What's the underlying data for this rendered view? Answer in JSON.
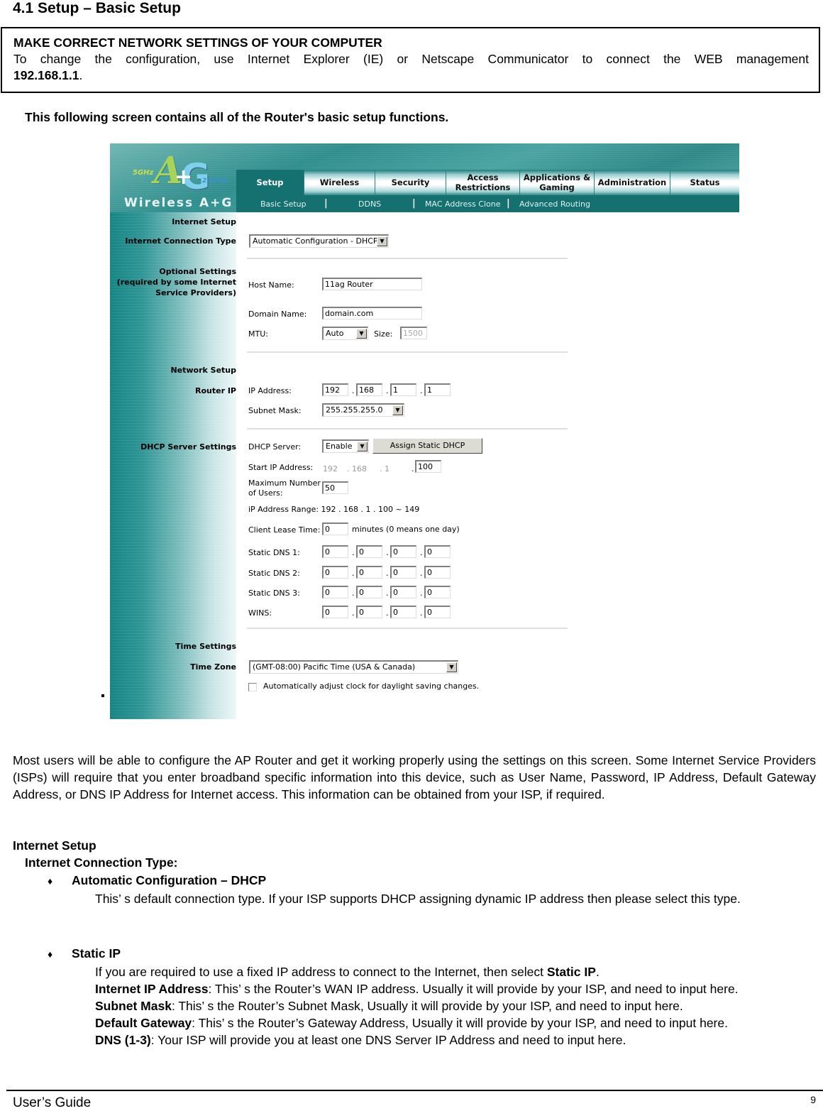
{
  "document": {
    "section_title": "4.1 Setup – Basic Setup",
    "notice": {
      "heading": "MAKE CORRECT NETWORK SETTINGS OF YOUR COMPUTER",
      "body": "To change the configuration, use Internet Explorer (IE) or Netscape Communicator to connect the WEB management",
      "ip": "192.168.1.1",
      "ip_suffix": "."
    },
    "intro": "This following screen contains all of the Router's basic setup functions.",
    "paragraph": "Most users will be able to configure the AP Router and get it working properly using the settings on this screen. Some Internet Service Providers (ISPs) will require that you enter broadband specific information into this device, such as User Name, Password, IP Address, Default Gateway Address, or DNS IP Address for Internet access. This information can be obtained from your ISP, if required.",
    "internet_setup_heading": "Internet Setup",
    "connection_type_heading": "Internet Connection Type:",
    "bullet_glyph": "♦",
    "bullets": [
      {
        "title": "Automatic Configuration – DHCP",
        "text": "This’ s default connection type. If your ISP supports DHCP assigning dynamic IP address then please select this type."
      },
      {
        "title": "Static IP",
        "lines": [
          {
            "pre": "If you are required to use a fixed IP address to connect to the Internet, then select ",
            "bold": "Static IP",
            "post": "."
          },
          {
            "bold": "Internet IP Address",
            "post": ": This’ s the Router’s WAN IP address. Usually it will provide by your ISP, and need to input here."
          },
          {
            "bold": "Subnet Mask",
            "post": ": This’ s the Router’s Subnet Mask, Usually it will provide by your ISP, and need to input here."
          },
          {
            "bold": "Default Gateway",
            "post": ": This’ s the Router’s Gateway Address, Usually it will provide by your ISP, and need to input here."
          },
          {
            "bold": "DNS (1-3)",
            "post": ": Your ISP will provide you at least one DNS Server IP Address and need to input here."
          }
        ]
      }
    ],
    "footer": {
      "left": "User’s Guide",
      "page": "9"
    }
  },
  "router_ui": {
    "logo": {
      "a": "A",
      "g": "G",
      "plus": "+",
      "band1": "5GHz",
      "band2": "2.4GHz",
      "wordmark": "Wireless A+G"
    },
    "tabs": [
      {
        "label": "Setup",
        "active": true
      },
      {
        "label": "Wireless"
      },
      {
        "label": "Security"
      },
      {
        "label": "Access Restrictions"
      },
      {
        "label": "Applications & Gaming"
      },
      {
        "label": "Administration"
      },
      {
        "label": "Status"
      }
    ],
    "subtabs": [
      "Basic Setup",
      "DDNS",
      "MAC Address Clone",
      "Advanced Routing"
    ],
    "subtab_separator": "|",
    "sections": {
      "internet_setup": "Internet Setup",
      "connection_type": "Internet Connection Type",
      "optional_settings": "Optional Settings",
      "optional_note1": "(required by some Internet",
      "optional_note2": "Service Providers)",
      "network_setup": "Network Setup",
      "router_ip": "Router IP",
      "dhcp_settings": "DHCP Server Settings",
      "time_settings": "Time Settings",
      "time_zone": "Time Zone"
    },
    "connection_type_value": "Automatic Configuration - DHCP",
    "host_name": {
      "label": "Host Name:",
      "value": "11ag Router"
    },
    "domain_name": {
      "label": "Domain Name:",
      "value": "domain.com"
    },
    "mtu": {
      "label": "MTU:",
      "value": "Auto",
      "size_label": "Size:",
      "size_value": "1500"
    },
    "ip_address": {
      "label": "IP Address:",
      "octets": [
        "192",
        "168",
        "1",
        "1"
      ]
    },
    "subnet_mask": {
      "label": "Subnet Mask:",
      "value": "255.255.255.0"
    },
    "dhcp_server": {
      "label": "DHCP Server:",
      "value": "Enable",
      "assign_button": "Assign Static DHCP"
    },
    "start_ip": {
      "label": "Start IP Address:",
      "fixed": [
        "192",
        ". 168",
        ". 1",
        "."
      ],
      "last": "100"
    },
    "max_users": {
      "label1": "Maximum Number",
      "label2": "of Users:",
      "value": "50"
    },
    "ip_range": "iP Address Range:  192 . 168 . 1 . 100 ~ 149",
    "lease_time": {
      "label": "Client Lease Time:",
      "value": "0",
      "suffix": "minutes (0 means one day)"
    },
    "dns_rows": [
      {
        "label": "Static DNS 1:",
        "octets": [
          "0",
          "0",
          "0",
          "0"
        ]
      },
      {
        "label": "Static DNS 2:",
        "octets": [
          "0",
          "0",
          "0",
          "0"
        ]
      },
      {
        "label": "Static DNS 3:",
        "octets": [
          "0",
          "0",
          "0",
          "0"
        ]
      },
      {
        "label": "WINS:",
        "octets": [
          "0",
          "0",
          "0",
          "0"
        ]
      }
    ],
    "time_zone_value": "(GMT-08:00) Pacific Time (USA & Canada)",
    "dst_label": "Automatically adjust clock for daylight saving changes.",
    "dst_checked": false,
    "dropdown_arrow": "▼",
    "octet_separator": "."
  }
}
